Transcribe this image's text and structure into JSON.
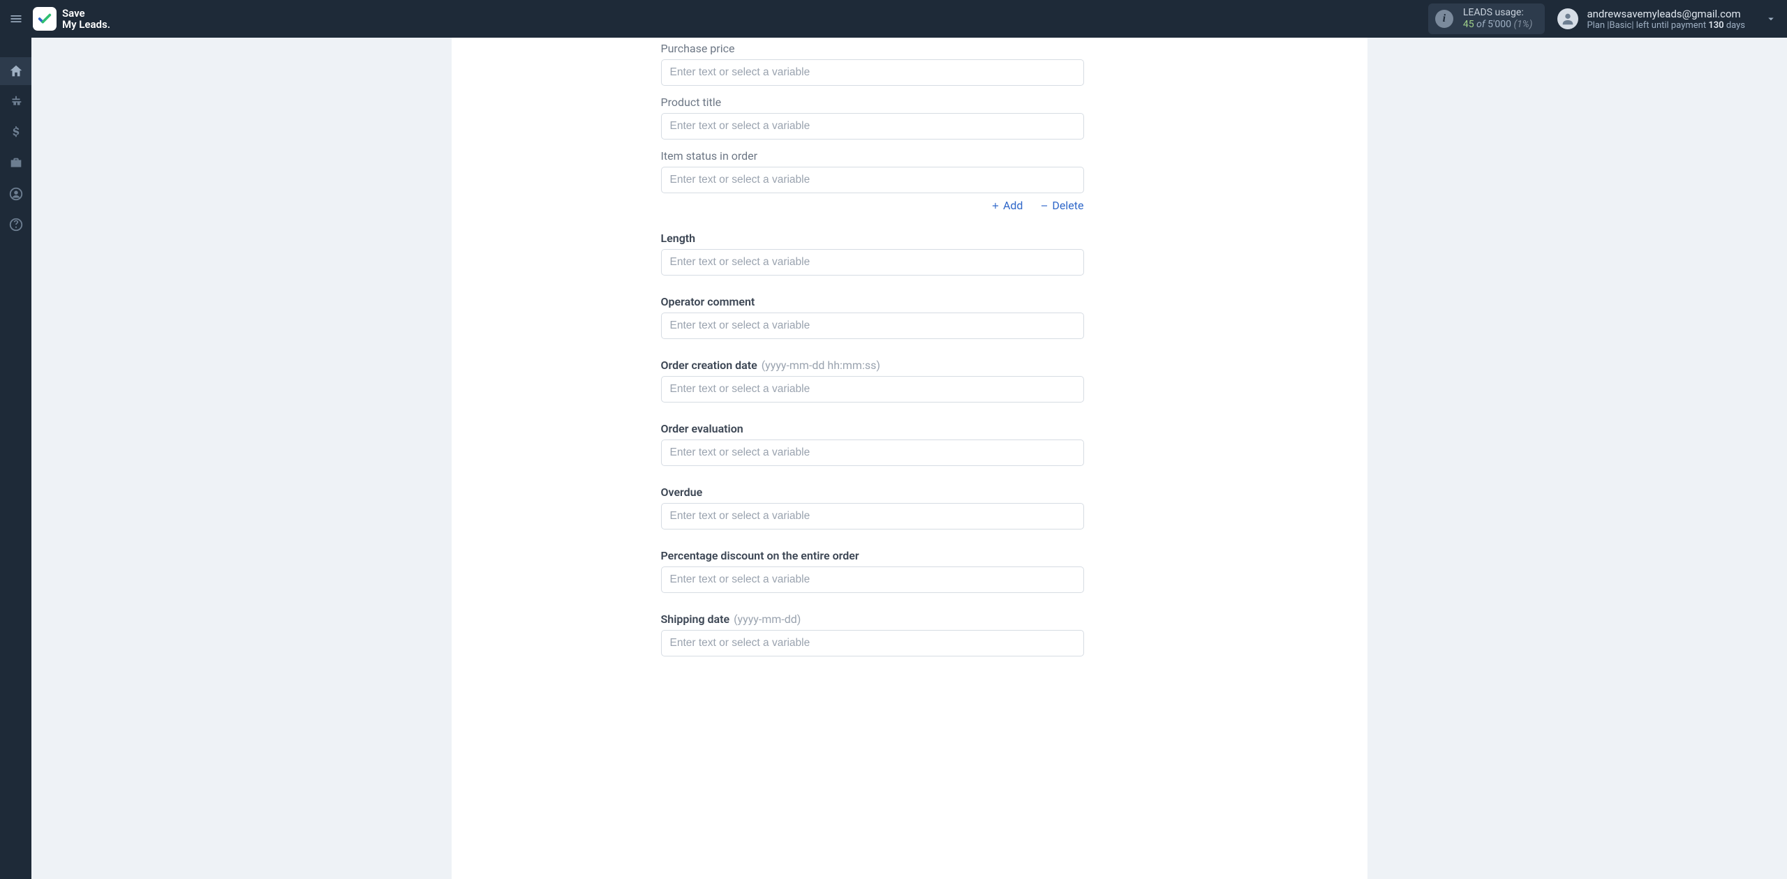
{
  "brand": {
    "line1": "Save",
    "line2": "My Leads."
  },
  "usage": {
    "label": "LEADS usage:",
    "used": "45",
    "of_word": "of",
    "total": "5'000",
    "pct": "(1%)"
  },
  "account": {
    "email": "andrewsavemyleads@gmail.com",
    "plan_prefix": "Plan |",
    "plan_name": "Basic",
    "plan_mid": "| left until payment ",
    "days_num": "130",
    "days_word": " days"
  },
  "placeholders": {
    "variable": "Enter text or select a variable"
  },
  "actions": {
    "add": "Add",
    "delete": "Delete"
  },
  "fields": {
    "purchase_price": {
      "label": "Purchase price"
    },
    "product_title": {
      "label": "Product title"
    },
    "item_status": {
      "label": "Item status in order"
    },
    "length": {
      "label": "Length"
    },
    "operator_comment": {
      "label": "Operator comment"
    },
    "order_created": {
      "label": "Order creation date",
      "hint": "(yyyy-mm-dd hh:mm:ss)"
    },
    "order_evaluation": {
      "label": "Order evaluation"
    },
    "overdue": {
      "label": "Overdue"
    },
    "pct_discount": {
      "label": "Percentage discount on the entire order"
    },
    "shipping_date": {
      "label": "Shipping date",
      "hint": "(yyyy-mm-dd)"
    }
  }
}
